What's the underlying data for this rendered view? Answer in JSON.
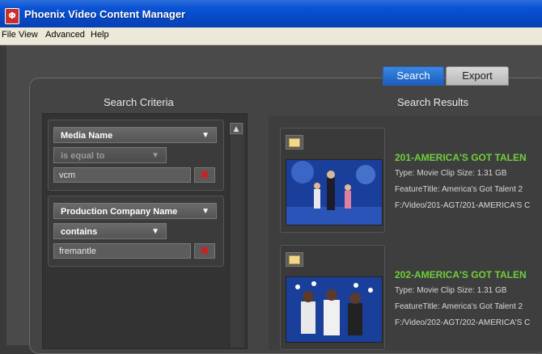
{
  "window": {
    "title": "Phoenix Video Content Manager"
  },
  "menu": {
    "items": [
      "File",
      "View",
      "Advanced",
      "Help"
    ]
  },
  "tabs": {
    "search": "Search",
    "export": "Export",
    "active": "Search"
  },
  "criteria": {
    "heading": "Search Criteria",
    "rows": [
      {
        "field": "Media Name",
        "operator": "is equal to",
        "value": "vcm"
      },
      {
        "field": "Production Company Name",
        "operator": "contains",
        "value": "fremantle"
      }
    ]
  },
  "results": {
    "heading": "Search Results",
    "items": [
      {
        "title": "201-AMERICA'S GOT TALEN",
        "type_line": "Type: Movie Clip   Size: 1.31 GB",
        "feature_line": "FeatureTitle: America's Got Talent 2",
        "path_line": "F:/Video/201-AGT/201-AMERICA'S C"
      },
      {
        "title": "202-AMERICA'S GOT TALEN",
        "type_line": "Type: Movie Clip   Size: 1.31 GB",
        "feature_line": "FeatureTitle: America's Got Talent 2",
        "path_line": "F:/Video/202-AGT/202-AMERICA'S C"
      }
    ]
  },
  "colors": {
    "result_title": "#6fcf3a",
    "active_tab": "#1a5cc0",
    "delete": "#e01818"
  },
  "icons": [
    "app-icon",
    "dropdown-arrow-icon",
    "delete-icon",
    "scroll-up-arrow-icon",
    "folder-icon"
  ]
}
